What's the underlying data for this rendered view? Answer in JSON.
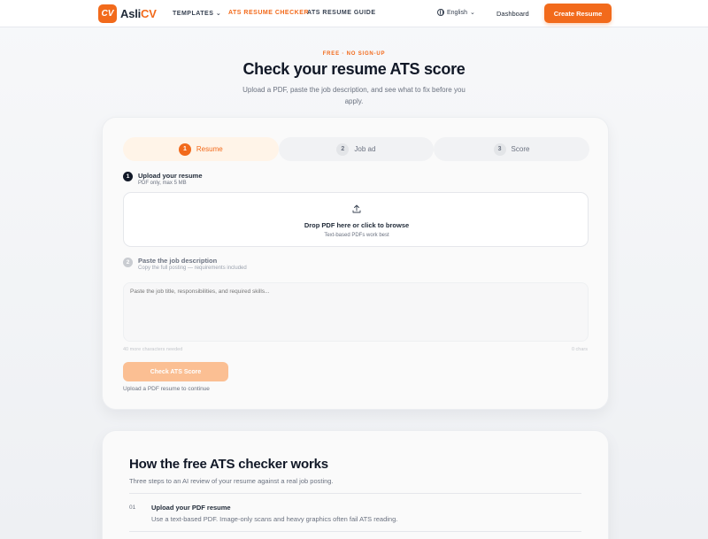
{
  "brand": {
    "mark": "CV",
    "name_prefix": "Asli",
    "name_suffix": "CV",
    "accent_color": "#f26a1b"
  },
  "nav": {
    "templates": "TEMPLATES",
    "ats_checker": "ATS RESUME CHECKER",
    "ats_guide": "ATS RESUME GUIDE",
    "language": "English",
    "dashboard": "Dashboard",
    "create_resume": "Create Resume"
  },
  "hero": {
    "kicker": "FREE · NO SIGN-UP",
    "title": "Check your resume ATS score",
    "subtitle": "Upload a PDF, paste the job description, and see what to fix before you apply."
  },
  "steps": [
    {
      "num": "1",
      "label": "Resume",
      "state": "active"
    },
    {
      "num": "2",
      "label": "Job ad",
      "state": "inactive"
    },
    {
      "num": "3",
      "label": "Score",
      "state": "inactive"
    }
  ],
  "upload": {
    "num": "1",
    "title": "Upload your resume",
    "hint": "PDF only, max 5 MB",
    "drop_main": "Drop PDF here or click to browse",
    "drop_sub": "Text-based PDFs work best",
    "icon": "upload-icon"
  },
  "job": {
    "num": "2",
    "title": "Paste the job description",
    "hint": "Copy the full posting — requirements included",
    "placeholder": "Paste the job title, responsibilities, and required skills...",
    "min_chars": "40 more characters needed",
    "char_count": "0 chars"
  },
  "actions": {
    "check": "Check ATS Score",
    "continue_hint": "Upload a PDF resume to continue"
  },
  "how": {
    "title": "How the free ATS checker works",
    "subtitle": "Three steps to an AI review of your resume against a real job posting.",
    "items": [
      {
        "num": "01",
        "title": "Upload your PDF resume",
        "desc": "Use a text-based PDF. Image-only scans and heavy graphics often fail ATS reading."
      }
    ]
  }
}
